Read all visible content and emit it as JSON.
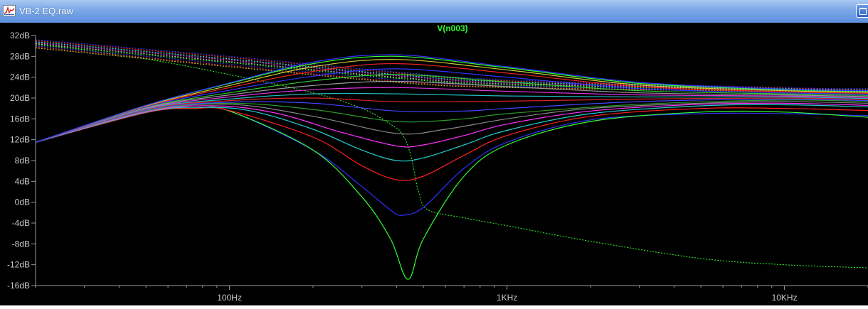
{
  "window": {
    "title": "VB-2 EQ.raw",
    "icon": "waveform-icon"
  },
  "colors": {
    "background": "#000000",
    "axis": "#9a9a9a",
    "tick_label": "#c8c8c8",
    "trace_title": "#33ff33"
  },
  "chart_data": {
    "type": "line",
    "title": "V(n003)",
    "x_scale": "log",
    "x_range_hz": [
      20,
      20000
    ],
    "y_range_db": [
      -16,
      32
    ],
    "y_ticks": [
      32,
      28,
      24,
      20,
      16,
      12,
      8,
      4,
      0,
      -4,
      -8,
      -12,
      -16
    ],
    "y_tick_labels": [
      "32dB",
      "28dB",
      "24dB",
      "20dB",
      "16dB",
      "12dB",
      "8dB",
      "4dB",
      "0dB",
      "-4dB",
      "-8dB",
      "-12dB",
      "-16dB"
    ],
    "x_ticks": [
      100,
      1000,
      10000
    ],
    "x_tick_labels": [
      "100Hz",
      "1KHz",
      "10KHz"
    ],
    "magnitude_curves": [
      {
        "color": "#3030ff",
        "points": [
          [
            20,
            11.5
          ],
          [
            50,
            17.2
          ],
          [
            75,
            18
          ],
          [
            100,
            17.5
          ],
          [
            200,
            10
          ],
          [
            300,
            3
          ],
          [
            380,
            -1.5
          ],
          [
            420,
            -2.5
          ],
          [
            500,
            -1
          ],
          [
            700,
            6.5
          ],
          [
            1000,
            11.5
          ],
          [
            2000,
            15.8
          ],
          [
            5000,
            17
          ],
          [
            10000,
            17
          ],
          [
            20000,
            16.6
          ]
        ]
      },
      {
        "color": "#33ff33",
        "points": [
          [
            20,
            11.5
          ],
          [
            50,
            17.2
          ],
          [
            75,
            18
          ],
          [
            100,
            17.5
          ],
          [
            200,
            10
          ],
          [
            300,
            1
          ],
          [
            380,
            -7
          ],
          [
            440,
            -14.8
          ],
          [
            500,
            -7
          ],
          [
            700,
            5
          ],
          [
            1000,
            11
          ],
          [
            2000,
            15.5
          ],
          [
            5000,
            17.3
          ],
          [
            10000,
            17.3
          ],
          [
            20000,
            16.3
          ]
        ]
      },
      {
        "color": "#ff2020",
        "points": [
          [
            20,
            11.5
          ],
          [
            50,
            17.2
          ],
          [
            75,
            18
          ],
          [
            100,
            17.6
          ],
          [
            200,
            12.5
          ],
          [
            300,
            7
          ],
          [
            400,
            4.3
          ],
          [
            500,
            5
          ],
          [
            700,
            9
          ],
          [
            1000,
            12.8
          ],
          [
            2000,
            16.5
          ],
          [
            5000,
            18
          ],
          [
            10000,
            18
          ],
          [
            20000,
            17.6
          ]
        ]
      },
      {
        "color": "#22cccc",
        "points": [
          [
            20,
            11.5
          ],
          [
            50,
            17.3
          ],
          [
            80,
            18.2
          ],
          [
            120,
            17.5
          ],
          [
            200,
            14
          ],
          [
            300,
            10
          ],
          [
            400,
            8
          ],
          [
            500,
            8.5
          ],
          [
            700,
            11
          ],
          [
            1000,
            13.8
          ],
          [
            2000,
            17
          ],
          [
            5000,
            18.5
          ],
          [
            10000,
            18.7
          ],
          [
            20000,
            18.3
          ]
        ]
      },
      {
        "color": "#ff33ff",
        "points": [
          [
            20,
            11.5
          ],
          [
            50,
            17.4
          ],
          [
            90,
            18.5
          ],
          [
            150,
            17
          ],
          [
            250,
            13.5
          ],
          [
            400,
            10.8
          ],
          [
            500,
            11
          ],
          [
            700,
            12.8
          ],
          [
            1000,
            15
          ],
          [
            2000,
            17.5
          ],
          [
            5000,
            18.8
          ],
          [
            10000,
            19
          ],
          [
            20000,
            18.6
          ]
        ]
      },
      {
        "color": "#888888",
        "points": [
          [
            20,
            11.5
          ],
          [
            50,
            17.5
          ],
          [
            100,
            18.8
          ],
          [
            200,
            16.5
          ],
          [
            400,
            13.2
          ],
          [
            600,
            14
          ],
          [
            1000,
            16
          ],
          [
            2000,
            18
          ],
          [
            5000,
            19
          ],
          [
            10000,
            19.3
          ],
          [
            20000,
            19
          ]
        ]
      },
      {
        "color": "#2a9a2a",
        "points": [
          [
            20,
            11.5
          ],
          [
            50,
            17.6
          ],
          [
            100,
            19
          ],
          [
            200,
            17.8
          ],
          [
            400,
            15.5
          ],
          [
            700,
            16
          ],
          [
            1000,
            17
          ],
          [
            3000,
            18.8
          ],
          [
            10000,
            19.6
          ],
          [
            20000,
            19.3
          ]
        ]
      },
      {
        "color": "#4444ff",
        "points": [
          [
            20,
            11.5
          ],
          [
            50,
            17.7
          ],
          [
            100,
            19.2
          ],
          [
            200,
            19
          ],
          [
            400,
            17.5
          ],
          [
            700,
            17.5
          ],
          [
            1000,
            18
          ],
          [
            3000,
            19.3
          ],
          [
            10000,
            19.8
          ],
          [
            20000,
            19.5
          ]
        ]
      },
      {
        "color": "#dd2222",
        "points": [
          [
            20,
            11.5
          ],
          [
            50,
            17.8
          ],
          [
            100,
            19.5
          ],
          [
            200,
            20
          ],
          [
            400,
            19.3
          ],
          [
            1000,
            19.4
          ],
          [
            3000,
            19.8
          ],
          [
            10000,
            20
          ],
          [
            20000,
            19.7
          ]
        ]
      },
      {
        "color": "#22bbbb",
        "points": [
          [
            20,
            11.5
          ],
          [
            50,
            17.9
          ],
          [
            100,
            19.8
          ],
          [
            200,
            20.8
          ],
          [
            400,
            20.8
          ],
          [
            1000,
            20.4
          ],
          [
            3000,
            20.2
          ],
          [
            10000,
            20.2
          ],
          [
            20000,
            19.9
          ]
        ]
      },
      {
        "color": "#dd33dd",
        "points": [
          [
            20,
            11.5
          ],
          [
            50,
            18
          ],
          [
            100,
            20.2
          ],
          [
            200,
            21.6
          ],
          [
            400,
            22
          ],
          [
            1000,
            21.3
          ],
          [
            3000,
            20.6
          ],
          [
            10000,
            20.4
          ],
          [
            20000,
            20.1
          ]
        ]
      },
      {
        "color": "#999999",
        "points": [
          [
            20,
            11.5
          ],
          [
            50,
            18.1
          ],
          [
            100,
            20.6
          ],
          [
            200,
            22.4
          ],
          [
            400,
            23.2
          ],
          [
            1000,
            22.2
          ],
          [
            3000,
            21
          ],
          [
            10000,
            20.6
          ],
          [
            20000,
            20.3
          ]
        ]
      },
      {
        "color": "#33cc33",
        "points": [
          [
            20,
            11.5
          ],
          [
            50,
            18.2
          ],
          [
            100,
            21
          ],
          [
            200,
            23.3
          ],
          [
            400,
            24.5
          ],
          [
            1000,
            23.1
          ],
          [
            3000,
            21.4
          ],
          [
            10000,
            20.8
          ],
          [
            20000,
            20.5
          ]
        ]
      },
      {
        "color": "#3333ff",
        "points": [
          [
            20,
            11.5
          ],
          [
            50,
            18.3
          ],
          [
            100,
            21.5
          ],
          [
            200,
            24.2
          ],
          [
            400,
            25.6
          ],
          [
            1000,
            24
          ],
          [
            3000,
            21.8
          ],
          [
            10000,
            21
          ],
          [
            20000,
            20.7
          ]
        ]
      },
      {
        "color": "#ee2222",
        "points": [
          [
            20,
            11.5
          ],
          [
            50,
            18.4
          ],
          [
            100,
            22
          ],
          [
            200,
            25.1
          ],
          [
            400,
            26.6
          ],
          [
            1000,
            24.8
          ],
          [
            3000,
            22.2
          ],
          [
            10000,
            21.2
          ],
          [
            20000,
            20.9
          ]
        ]
      },
      {
        "color": "#cccc33",
        "points": [
          [
            20,
            11.5
          ],
          [
            50,
            18.5
          ],
          [
            100,
            22.4
          ],
          [
            200,
            26
          ],
          [
            400,
            27.4
          ],
          [
            1000,
            25.4
          ],
          [
            3000,
            22.5
          ],
          [
            10000,
            21.4
          ],
          [
            20000,
            21.1
          ]
        ]
      },
      {
        "color": "#33ff33",
        "points": [
          [
            20,
            11.5
          ],
          [
            50,
            18.6
          ],
          [
            100,
            22.8
          ],
          [
            200,
            26.6
          ],
          [
            400,
            28
          ],
          [
            1000,
            25.8
          ],
          [
            3000,
            22.8
          ],
          [
            10000,
            21.6
          ],
          [
            20000,
            21.3
          ]
        ]
      },
      {
        "color": "#3333ff",
        "points": [
          [
            20,
            11.5
          ],
          [
            50,
            18.6
          ],
          [
            100,
            22.9
          ],
          [
            200,
            26.9
          ],
          [
            400,
            28.3
          ],
          [
            1000,
            26
          ],
          [
            3000,
            23
          ],
          [
            10000,
            21.7
          ],
          [
            20000,
            21.4
          ]
        ]
      }
    ],
    "phase_curves": [
      {
        "color": "#33ff33",
        "points": [
          [
            20,
            30.5
          ],
          [
            50,
            27.5
          ],
          [
            100,
            24.5
          ],
          [
            200,
            21
          ],
          [
            300,
            18
          ],
          [
            380,
            15
          ],
          [
            420,
            13
          ],
          [
            450,
            9
          ],
          [
            480,
            2
          ],
          [
            520,
            -1.5
          ],
          [
            700,
            -3
          ],
          [
            1000,
            -4.5
          ],
          [
            2000,
            -7.5
          ],
          [
            5000,
            -10.8
          ],
          [
            10000,
            -12
          ],
          [
            20000,
            -12.6
          ]
        ]
      },
      {
        "color": "#3333ff",
        "points": [
          [
            20,
            31.2
          ],
          [
            100,
            28
          ],
          [
            400,
            25
          ],
          [
            1000,
            23.5
          ],
          [
            10000,
            22
          ],
          [
            20000,
            21.8
          ]
        ]
      },
      {
        "color": "#ff3333",
        "points": [
          [
            20,
            31
          ],
          [
            100,
            27.8
          ],
          [
            400,
            24.8
          ],
          [
            1000,
            23.3
          ],
          [
            10000,
            21.9
          ],
          [
            20000,
            21.6
          ]
        ]
      },
      {
        "color": "#33ffff",
        "points": [
          [
            20,
            30.8
          ],
          [
            100,
            27.5
          ],
          [
            400,
            24.5
          ],
          [
            1000,
            23.1
          ],
          [
            10000,
            21.8
          ],
          [
            20000,
            21.5
          ]
        ]
      },
      {
        "color": "#ff33ff",
        "points": [
          [
            20,
            30.6
          ],
          [
            100,
            27.3
          ],
          [
            400,
            24.3
          ],
          [
            1000,
            22.9
          ],
          [
            10000,
            21.7
          ],
          [
            20000,
            21.4
          ]
        ]
      },
      {
        "color": "#cccccc",
        "points": [
          [
            20,
            30.4
          ],
          [
            100,
            27
          ],
          [
            400,
            24
          ],
          [
            1000,
            22.7
          ],
          [
            10000,
            21.6
          ],
          [
            20000,
            21.3
          ]
        ]
      },
      {
        "color": "#33ff33",
        "points": [
          [
            20,
            30.2
          ],
          [
            100,
            26.8
          ],
          [
            400,
            23.8
          ],
          [
            1000,
            22.5
          ],
          [
            10000,
            21.5
          ],
          [
            20000,
            21.2
          ]
        ]
      },
      {
        "color": "#3333ff",
        "points": [
          [
            20,
            30
          ],
          [
            100,
            26.5
          ],
          [
            400,
            23.5
          ],
          [
            1000,
            22.3
          ],
          [
            10000,
            21.4
          ],
          [
            20000,
            21.1
          ]
        ]
      },
      {
        "color": "#ff3333",
        "points": [
          [
            20,
            29.8
          ],
          [
            100,
            26.2
          ],
          [
            400,
            23.2
          ],
          [
            1000,
            22.1
          ],
          [
            10000,
            21.3
          ],
          [
            20000,
            21
          ]
        ]
      },
      {
        "color": "#cccc33",
        "points": [
          [
            20,
            29.6
          ],
          [
            100,
            26
          ],
          [
            400,
            23
          ],
          [
            1000,
            22
          ],
          [
            10000,
            21.2
          ],
          [
            20000,
            20.9
          ]
        ]
      }
    ]
  }
}
